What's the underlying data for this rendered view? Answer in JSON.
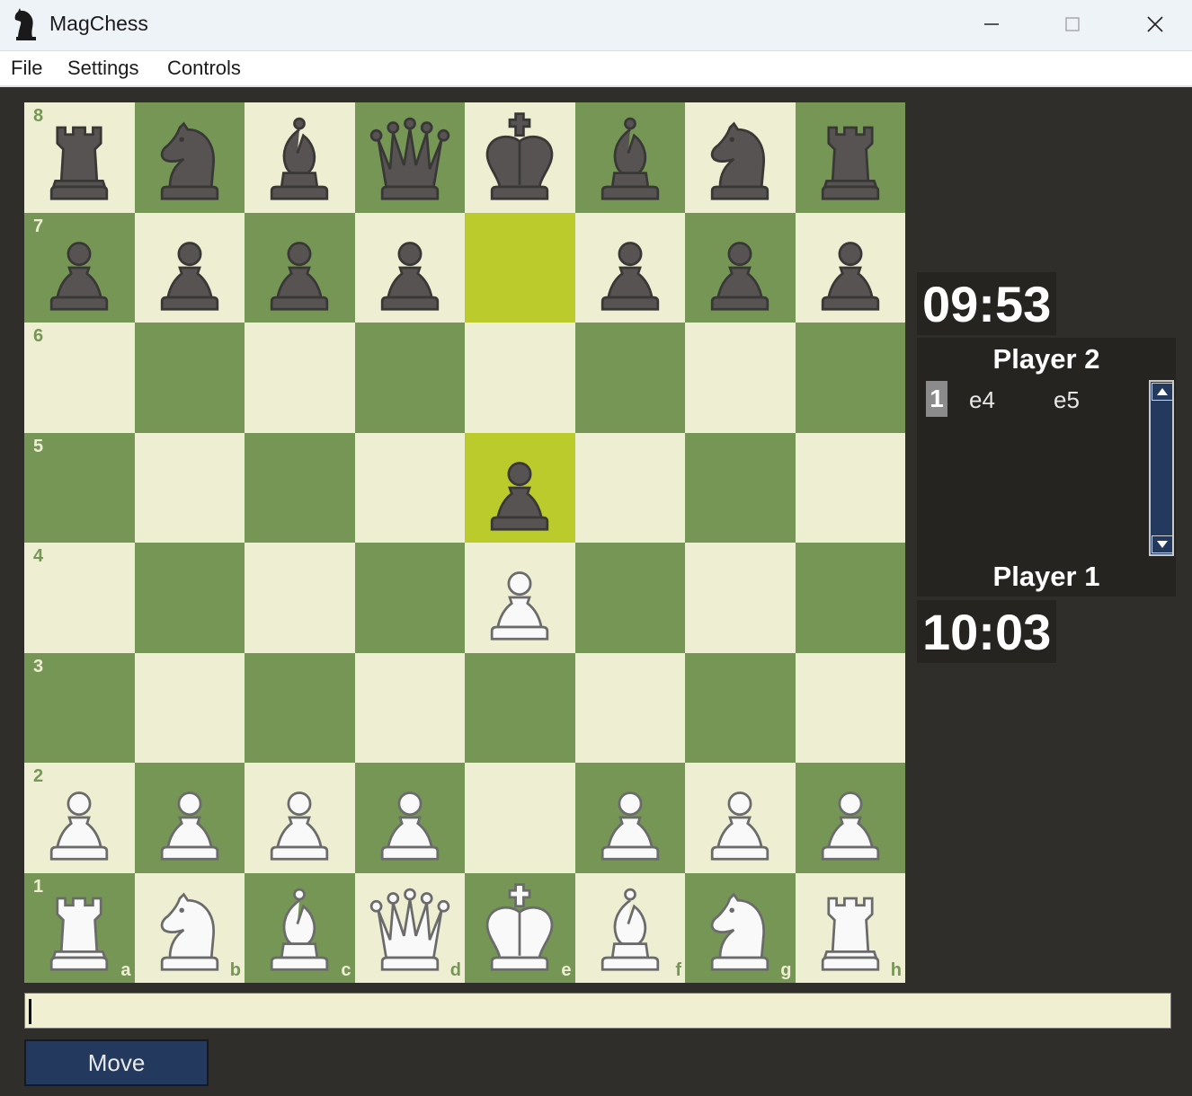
{
  "window": {
    "title": "MagChess"
  },
  "menu": {
    "items": [
      "File",
      "Settings",
      "Controls"
    ]
  },
  "board": {
    "ranks": [
      "8",
      "7",
      "6",
      "5",
      "4",
      "3",
      "2",
      "1"
    ],
    "files": [
      "a",
      "b",
      "c",
      "d",
      "e",
      "f",
      "g",
      "h"
    ],
    "highlighted_squares": [
      "e7",
      "e5"
    ],
    "position": [
      [
        "br",
        "bn",
        "bb",
        "bq",
        "bk",
        "bb",
        "bn",
        "br"
      ],
      [
        "bp",
        "bp",
        "bp",
        "bp",
        "",
        "bp",
        "bp",
        "bp"
      ],
      [
        "",
        "",
        "",
        "",
        "",
        "",
        "",
        ""
      ],
      [
        "",
        "",
        "",
        "",
        "bp",
        "",
        "",
        ""
      ],
      [
        "",
        "",
        "",
        "",
        "wp",
        "",
        "",
        ""
      ],
      [
        "",
        "",
        "",
        "",
        "",
        "",
        "",
        ""
      ],
      [
        "wp",
        "wp",
        "wp",
        "wp",
        "",
        "wp",
        "wp",
        "wp"
      ],
      [
        "wr",
        "wn",
        "wb",
        "wq",
        "wk",
        "wb",
        "wn",
        "wr"
      ]
    ],
    "colors": {
      "light": "#eeeed2",
      "dark": "#769656",
      "highlight": "#bbcb2b"
    }
  },
  "players": {
    "top": {
      "name": "Player 2",
      "clock": "09:53"
    },
    "bottom": {
      "name": "Player 1",
      "clock": "10:03"
    }
  },
  "moves": [
    {
      "number": "1",
      "white": "e4",
      "black": "e5"
    }
  ],
  "command_input": {
    "value": ""
  },
  "buttons": {
    "move": "Move"
  }
}
